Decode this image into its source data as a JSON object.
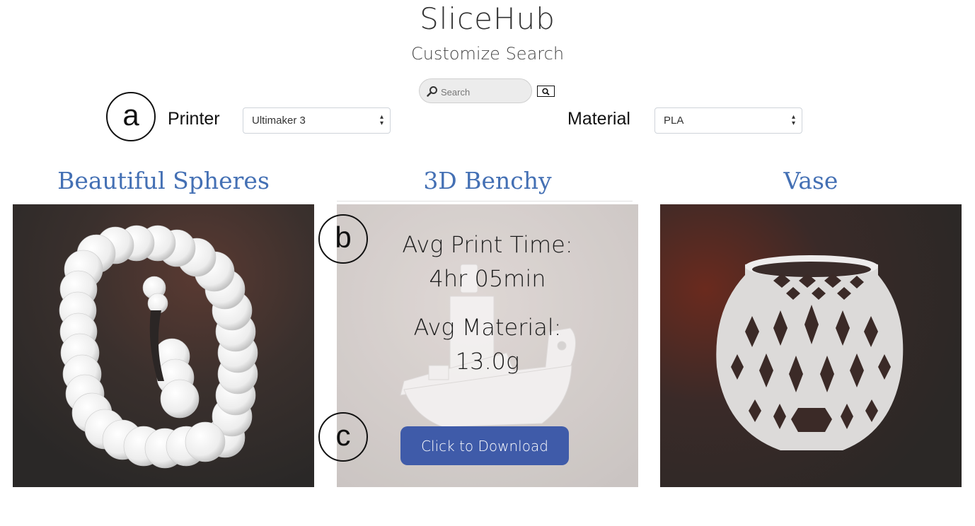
{
  "header": {
    "title": "SliceHub",
    "subtitle": "Customize Search"
  },
  "search": {
    "placeholder": "Search",
    "value": "",
    "icon": "search-icon",
    "button_icon": "magnifier-icon"
  },
  "filters": {
    "printer": {
      "label": "Printer",
      "selected": "Ultimaker 3"
    },
    "material": {
      "label": "Material",
      "selected": "PLA"
    }
  },
  "markers": {
    "a": "a",
    "b": "b",
    "c": "c"
  },
  "models": [
    {
      "title": "Beautiful Spheres"
    },
    {
      "title": "3D Benchy",
      "print_time_label": "Avg Print Time:",
      "print_time": "4hr 05min",
      "material_label": "Avg Material:",
      "material": "13.0g",
      "download_label": "Click to Download"
    },
    {
      "title": "Vase"
    }
  ],
  "colors": {
    "title_blue": "#4470b4",
    "button_blue": "#3f5ba9"
  }
}
